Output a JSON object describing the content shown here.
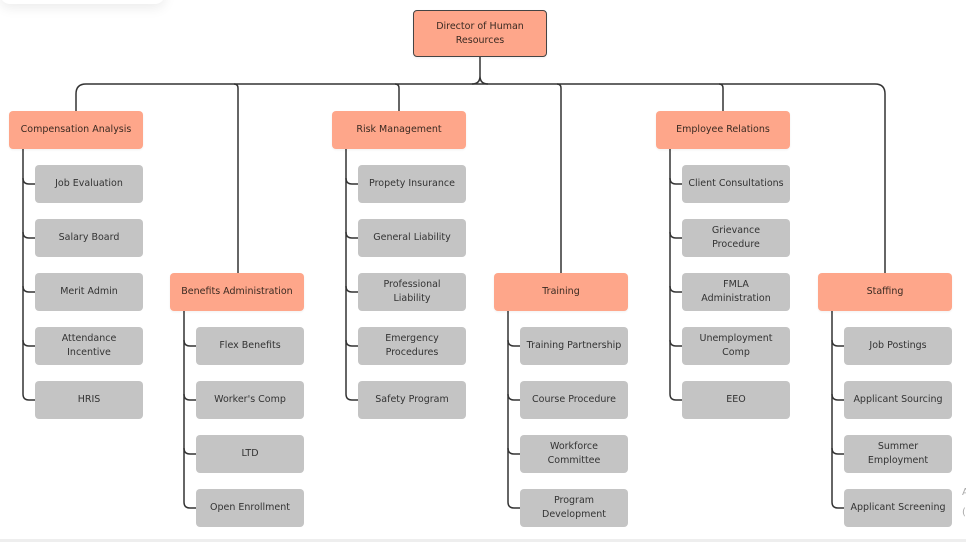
{
  "diagram": {
    "type": "org-chart",
    "colors": {
      "primary_node": "#fea68a",
      "secondary_node": "#c4c4c4",
      "connector": "#333333"
    },
    "root": {
      "label": "Director of Human Resources"
    },
    "departments": [
      {
        "label": "Compensation Analysis",
        "children": [
          "Job Evaluation",
          "Salary Board",
          "Merit Admin",
          "Attendance Incentive",
          "HRIS"
        ]
      },
      {
        "label": "Benefits Administration",
        "children": [
          "Flex Benefits",
          "Worker's Comp",
          "LTD",
          "Open Enrollment"
        ]
      },
      {
        "label": "Risk Management",
        "children": [
          "Propety Insurance",
          "General Liability",
          "Professional Liability",
          "Emergency Procedures",
          "Safety Program"
        ]
      },
      {
        "label": "Training",
        "children": [
          "Training Partnership",
          "Course Procedure",
          "Workforce Committee",
          "Program Development"
        ]
      },
      {
        "label": "Employee Relations",
        "children": [
          "Client Consultations",
          "Grievance Procedure",
          "FMLA Administration",
          "Unemployment Comp",
          "EEO"
        ]
      },
      {
        "label": "Staffing",
        "children": [
          "Job Postings",
          "Applicant Sourcing",
          "Summer Employment",
          "Applicant Screening"
        ]
      }
    ]
  }
}
